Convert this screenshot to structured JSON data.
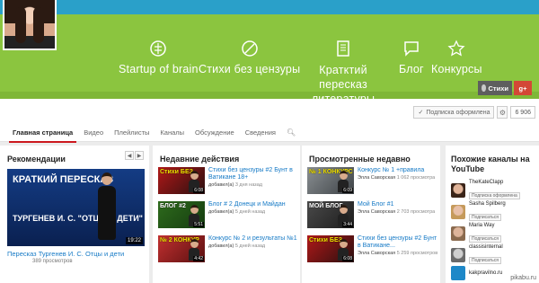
{
  "banner": {
    "nav": [
      {
        "label": "Startup of brain",
        "icon": "brain-icon"
      },
      {
        "label": "Стихи без цензуры",
        "icon": "no-sign-icon"
      },
      {
        "label": "Кратктий пересказ литературы",
        "icon": "book-icon"
      },
      {
        "label": "Блог",
        "icon": "speech-bubble-icon"
      },
      {
        "label": "Конкурсы",
        "icon": "star-icon"
      }
    ],
    "social": {
      "stihi": "Стихи",
      "gplus": "g+"
    }
  },
  "subscribe": {
    "label": "Подписка оформлена",
    "count": "6 906"
  },
  "tabs": [
    "Главная страница",
    "Видео",
    "Плейлисты",
    "Каналы",
    "Обсуждение",
    "Сведения"
  ],
  "recommend": {
    "title": "Рекомендации",
    "video": {
      "thumb_top": "КРАТКИЙ ПЕРЕСКАЗ",
      "thumb_bottom": "ТУРГЕНЕВ И. С. \"ОТЦЫ И ДЕТИ\"",
      "duration": "19:22",
      "title": "Пересказ Тургенев И. С. Отцы и дети",
      "views": "389 просмотров"
    }
  },
  "recent": {
    "title": "Недавние действия",
    "items": [
      {
        "title": "Стихи без цензуры #2 Бунт в Ватикане 18+",
        "meta_pre": "добавил(а)",
        "meta": "3 дня назад",
        "thumb": "Стихи БЕЗ",
        "duration": "6:08"
      },
      {
        "title": "Блог # 2 Донецк и Майдан",
        "meta_pre": "добавил(а)",
        "meta": "5 дней назад",
        "thumb": "БЛОГ #2",
        "duration": "5:51"
      },
      {
        "title": "Конкурс № 2 и результаты №1",
        "meta_pre": "добавил(а)",
        "meta": "5 дней назад",
        "thumb": "№ 2 КОНКУР",
        "duration": "4:42"
      }
    ]
  },
  "watched": {
    "title": "Просмотренные недавно",
    "items": [
      {
        "title": "Конкурс № 1 +правила",
        "author": "Элла Саворская",
        "views": "1 062 просмотра",
        "thumb": "№ 1 КОНКУРС",
        "duration": "6:09"
      },
      {
        "title": "Мой Блог #1",
        "author": "Элла Саворская",
        "views": "2 703 просмотра",
        "thumb": "МОЙ БЛОГ",
        "duration": "3:44"
      },
      {
        "title": "Стихи без цензуры #2 Бунт в Ватикане...",
        "author": "Элла Саворская",
        "views": "5 259 просмотров",
        "thumb": "Стихи БЕЗ",
        "duration": "6:08"
      }
    ]
  },
  "related": {
    "title": "Похожие каналы на YouTube",
    "channels": [
      {
        "name": "TheKateClapp",
        "button": "Подписка оформлена"
      },
      {
        "name": "Sasha Spilberg",
        "button": "Подписаться"
      },
      {
        "name": "Maria Way",
        "button": "Подписаться"
      },
      {
        "name": "classisinternal",
        "button": "Подписаться"
      },
      {
        "name": "kakpravilno.ru",
        "button": ""
      }
    ]
  },
  "watermark": "pikabu.ru",
  "colors": {
    "banner_green": "#8bc53f",
    "banner_blue": "#2aa0c9",
    "link": "#167ac6",
    "tab_active": "#cc181e"
  }
}
